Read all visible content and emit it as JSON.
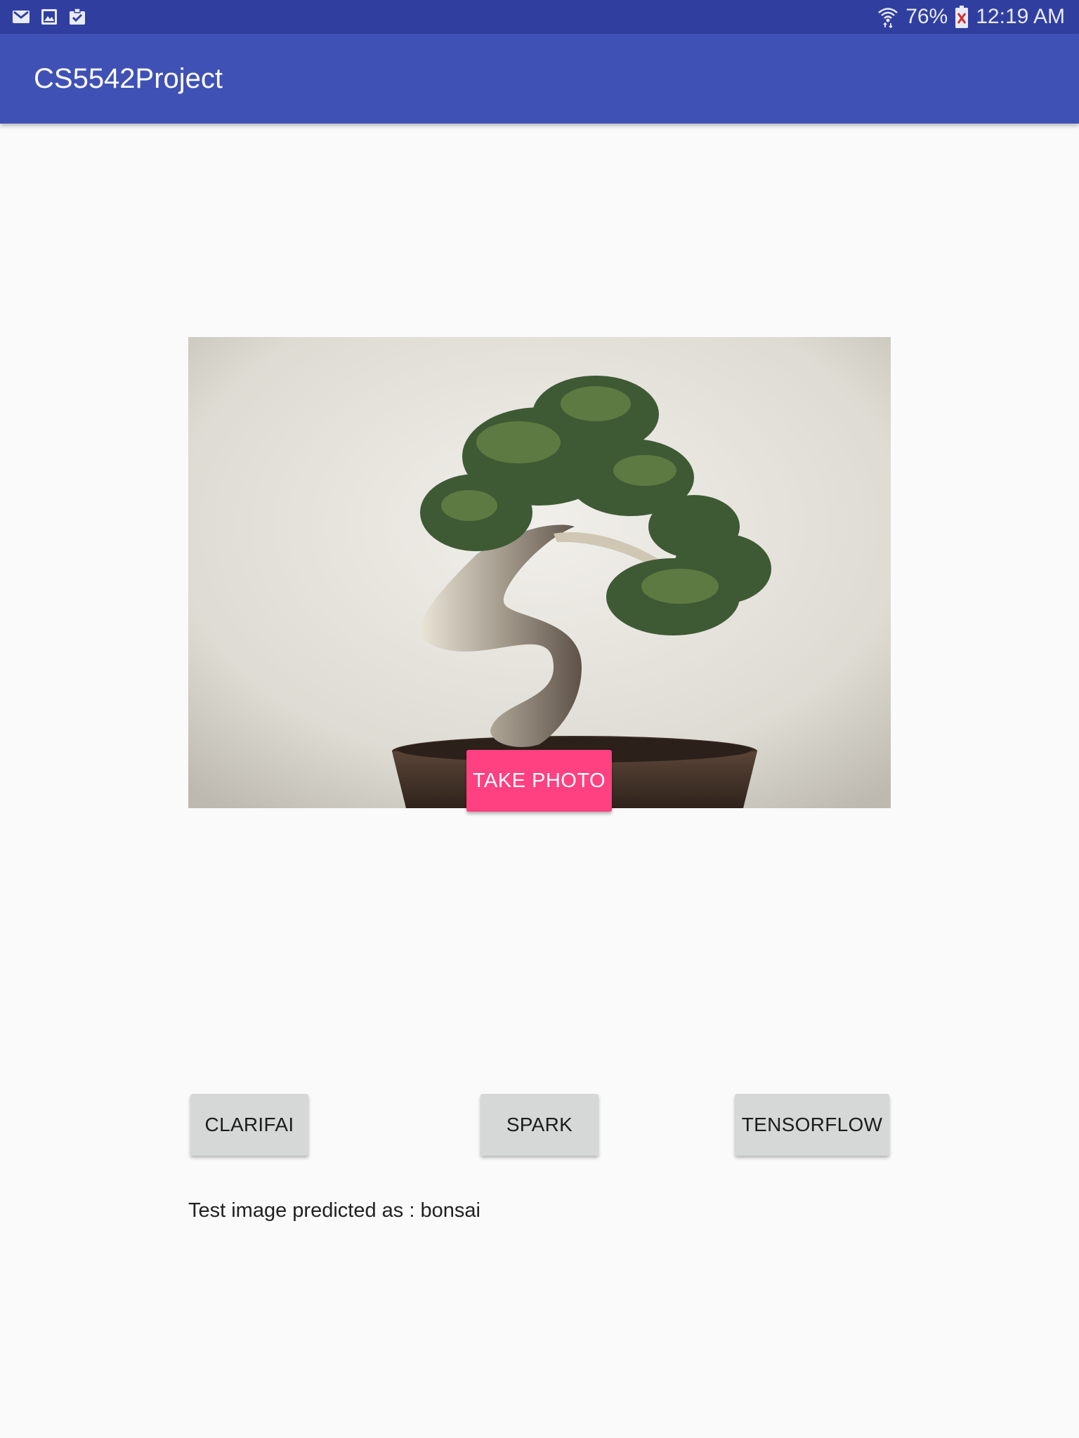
{
  "status_bar": {
    "left_icons": [
      "gmail-icon",
      "gallery-icon",
      "clipboard-check-icon"
    ],
    "battery_percent": "76%",
    "time": "12:19 AM",
    "wifi_icon": "wifi-icon",
    "battery_icon": "battery-charging-icon"
  },
  "app_bar": {
    "title": "CS5542Project",
    "color": "#3f51b5"
  },
  "photo": {
    "subject_icon": "bonsai-photo"
  },
  "buttons": {
    "take_photo": "TAKE PHOTO",
    "take_photo_color": "#ff4081",
    "clarifai": "CLARIFAI",
    "spark": "SPARK",
    "tensorflow": "TENSORFLOW"
  },
  "result": {
    "text": "Test image predicted as : bonsai"
  }
}
